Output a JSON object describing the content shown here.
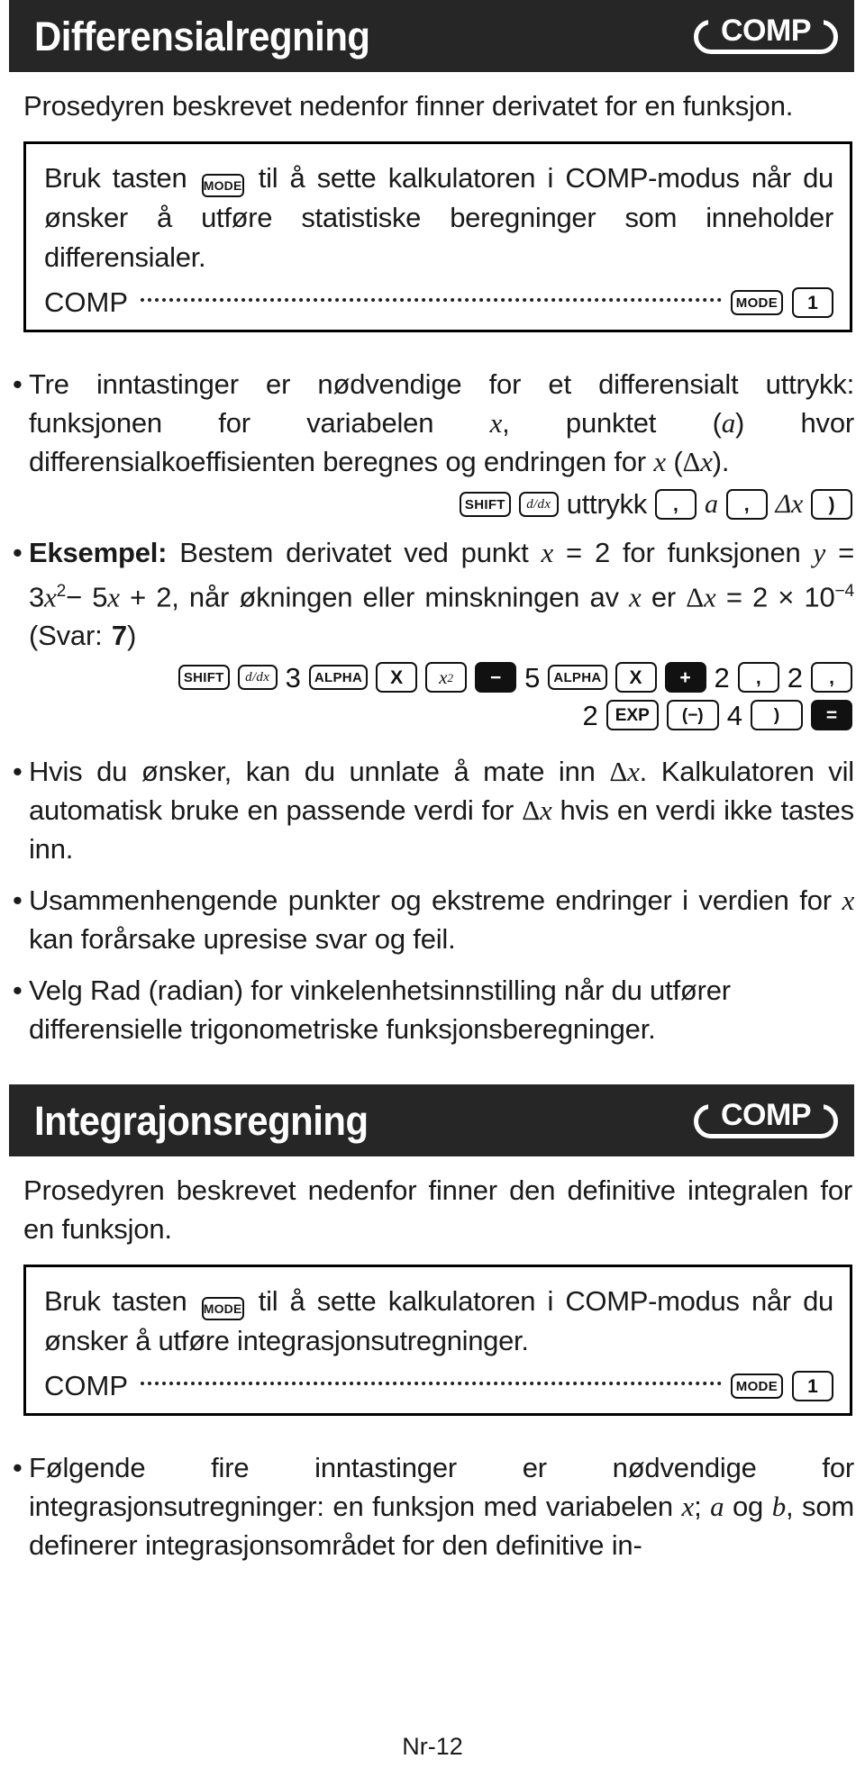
{
  "section1": {
    "title": "Differensialregning",
    "badge": "COMP",
    "intro": "Prosedyren beskrevet nedenfor finner derivatet for en funksjon.",
    "mode_box": {
      "text_before_key": "Bruk tasten",
      "key": "MODE",
      "text_after_key": "til å sette kalkulatoren i COMP-modus når du ønsker å utføre statistiske beregninger som inneholder differensialer.",
      "mode_label": "COMP",
      "mode_keys": [
        "MODE",
        "1"
      ]
    },
    "bullets": [
      {
        "id": "three-inputs",
        "text_parts": [
          {
            "t": "Tre inntastinger er nødvendige for et differensialt uttrykk: funksjonen for variabelen ",
            "style": "normal"
          },
          {
            "t": "x",
            "style": "italic"
          },
          {
            "t": ", punktet (",
            "style": "normal"
          },
          {
            "t": "a",
            "style": "italic"
          },
          {
            "t": ") hvor differensialkoeffisienten beregnes og endringen for ",
            "style": "normal"
          },
          {
            "t": "x",
            "style": "italic"
          },
          {
            "t": " (Δ",
            "style": "normal"
          },
          {
            "t": "x",
            "style": "italic"
          },
          {
            "t": ").",
            "style": "normal"
          }
        ]
      }
    ],
    "syntax_sequence": [
      {
        "type": "key",
        "label": "SHIFT",
        "variant": "small"
      },
      {
        "type": "key",
        "label": "d/dx",
        "variant": "small-italic"
      },
      {
        "type": "text",
        "label": "uttrykk"
      },
      {
        "type": "key",
        "label": ",",
        "variant": "med"
      },
      {
        "type": "text-italic",
        "label": "a"
      },
      {
        "type": "key",
        "label": ",",
        "variant": "med"
      },
      {
        "type": "text-italic",
        "label": "Δx"
      },
      {
        "type": "key",
        "label": ")",
        "variant": "med"
      }
    ],
    "example": {
      "label": "Eksempel:",
      "text": "Bestem derivatet ved punkt x = 2 for funksjonen y = 3x² − 5x + 2, når økningen eller minskningen av x er Δx = 2 × 10⁻⁴ (Svar: 7)",
      "answer": "7"
    },
    "example_sequence_row1": [
      {
        "label": "SHIFT",
        "kind": "key-small"
      },
      {
        "label": "d/dx",
        "kind": "key-small-italic"
      },
      {
        "label": "3",
        "kind": "num"
      },
      {
        "label": "ALPHA",
        "kind": "key-small"
      },
      {
        "label": "X",
        "kind": "key-med"
      },
      {
        "label": "x²",
        "kind": "key-med-italic"
      },
      {
        "label": "−",
        "kind": "key-inv"
      },
      {
        "label": "5",
        "kind": "num"
      },
      {
        "label": "ALPHA",
        "kind": "key-small"
      },
      {
        "label": "X",
        "kind": "key-med"
      },
      {
        "label": "+",
        "kind": "key-inv"
      },
      {
        "label": "2",
        "kind": "num"
      },
      {
        "label": ",",
        "kind": "key-med"
      },
      {
        "label": "2",
        "kind": "num"
      },
      {
        "label": ",",
        "kind": "key-med"
      }
    ],
    "example_sequence_row2": [
      {
        "label": "2",
        "kind": "num"
      },
      {
        "label": "EXP",
        "kind": "key-wide"
      },
      {
        "label": "(−)",
        "kind": "key-wide"
      },
      {
        "label": "4",
        "kind": "num"
      },
      {
        "label": ")",
        "kind": "key-med"
      },
      {
        "label": "=",
        "kind": "key-inv"
      }
    ],
    "notes": [
      "Hvis du ønsker, kan du unnlate å mate inn Δx. Kalkulatoren vil automatisk bruke en passende verdi for Δx hvis en verdi ikke tastes inn.",
      "Usammenhengende punkter og ekstreme endringer i verdien for x kan forårsake upresise svar og feil.",
      "Velg Rad (radian) for vinkelenhetsinnstilling når du utfører differensielle trigonometriske funksjonsberegninger."
    ]
  },
  "section2": {
    "title": "Integrajonsregning",
    "badge": "COMP",
    "intro": "Prosedyren beskrevet nedenfor finner den definitive integralen for en funksjon.",
    "mode_box": {
      "text_before_key": "Bruk tasten",
      "key": "MODE",
      "text_after_key": "til å sette kalkulatoren i COMP-modus når du ønsker å utføre integrasjonsutregninger.",
      "mode_label": "COMP",
      "mode_keys": [
        "MODE",
        "1"
      ]
    },
    "bullet": "Følgende fire inntastinger er nødvendige for integrasjonsutregninger: en funksjon med variabelen x; a og b, som definerer integrasjonsområdet for den definitive in-"
  },
  "footer": {
    "page_label": "Nr-12"
  },
  "colors": {
    "header_bg": "#262626",
    "header_fg": "#ffffff",
    "text": "#1a1a1a",
    "key_inverted_bg": "#111111"
  }
}
